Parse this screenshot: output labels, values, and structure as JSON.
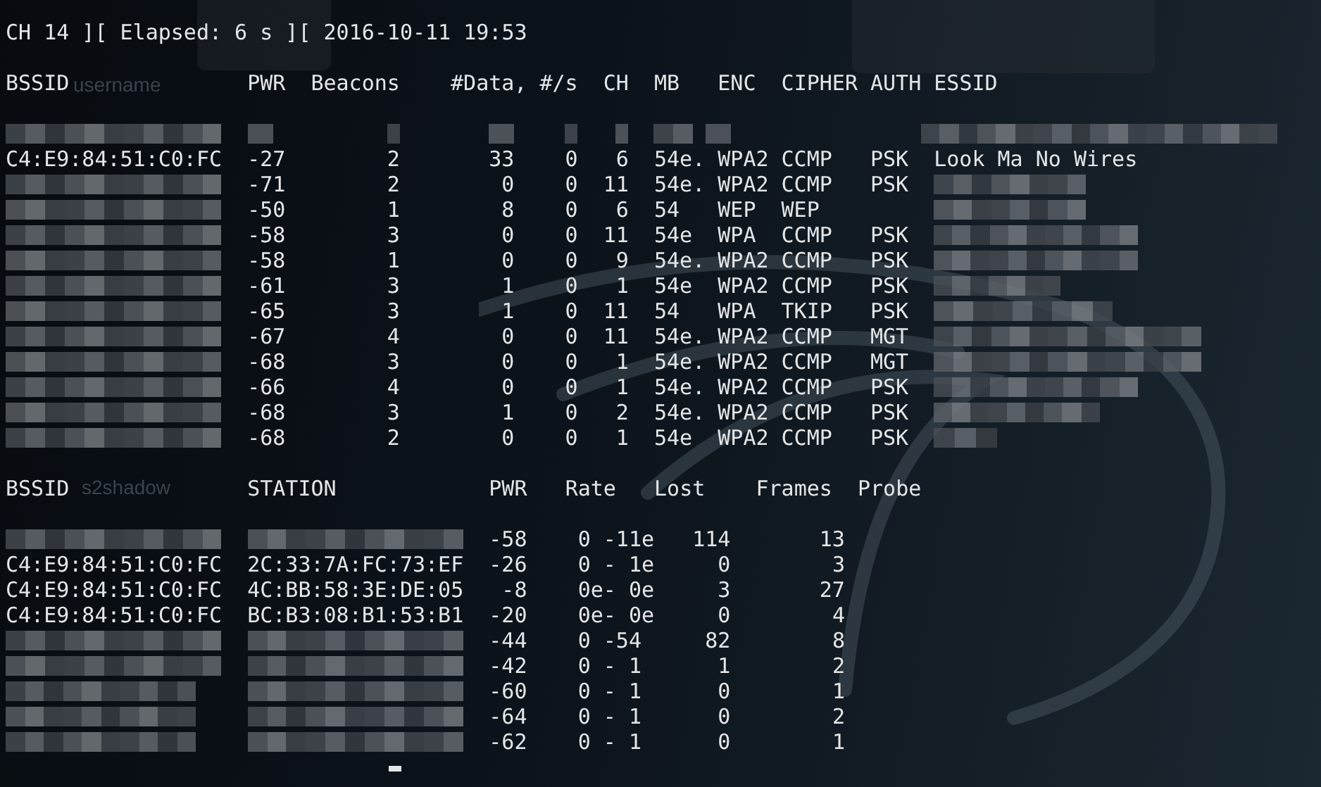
{
  "status_line": "CH 14 ][ Elapsed: 6 s ][ 2016-10-11 19:53",
  "desktop_icons": [
    {
      "label": "username"
    },
    {
      "label": "s2shadow"
    }
  ],
  "access_points": {
    "columns": [
      "BSSID",
      "PWR",
      "Beacons",
      "#Data, #/s",
      "CH",
      "MB",
      "ENC",
      "CIPHER",
      "AUTH",
      "ESSID"
    ],
    "rows": [
      {
        "redacted": true
      },
      {
        "bssid": "C4:E9:84:51:C0:FC",
        "pwr": "-27",
        "beacons": "2",
        "data": "33",
        "per_sec": "0",
        "ch": "6",
        "mb": "54e.",
        "enc": "WPA2",
        "cipher": "CCMP",
        "auth": "PSK",
        "essid": "Look Ma No Wires"
      },
      {
        "pwr": "-71",
        "beacons": "2",
        "data": "0",
        "per_sec": "0",
        "ch": "11",
        "mb": "54e.",
        "enc": "WPA2",
        "cipher": "CCMP",
        "auth": "PSK"
      },
      {
        "pwr": "-50",
        "beacons": "1",
        "data": "8",
        "per_sec": "0",
        "ch": "6",
        "mb": "54",
        "enc": "WEP",
        "cipher": "WEP"
      },
      {
        "pwr": "-58",
        "beacons": "3",
        "data": "0",
        "per_sec": "0",
        "ch": "11",
        "mb": "54e",
        "enc": "WPA",
        "cipher": "CCMP",
        "auth": "PSK"
      },
      {
        "pwr": "-58",
        "beacons": "1",
        "data": "0",
        "per_sec": "0",
        "ch": "9",
        "mb": "54e.",
        "enc": "WPA2",
        "cipher": "CCMP",
        "auth": "PSK"
      },
      {
        "pwr": "-61",
        "beacons": "3",
        "data": "1",
        "per_sec": "0",
        "ch": "1",
        "mb": "54e",
        "enc": "WPA2",
        "cipher": "CCMP",
        "auth": "PSK"
      },
      {
        "pwr": "-65",
        "beacons": "3",
        "data": "1",
        "per_sec": "0",
        "ch": "11",
        "mb": "54",
        "enc": "WPA",
        "cipher": "TKIP",
        "auth": "PSK"
      },
      {
        "pwr": "-67",
        "beacons": "4",
        "data": "0",
        "per_sec": "0",
        "ch": "11",
        "mb": "54e.",
        "enc": "WPA2",
        "cipher": "CCMP",
        "auth": "MGT"
      },
      {
        "pwr": "-68",
        "beacons": "3",
        "data": "0",
        "per_sec": "0",
        "ch": "1",
        "mb": "54e.",
        "enc": "WPA2",
        "cipher": "CCMP",
        "auth": "MGT"
      },
      {
        "pwr": "-66",
        "beacons": "4",
        "data": "0",
        "per_sec": "0",
        "ch": "1",
        "mb": "54e.",
        "enc": "WPA2",
        "cipher": "CCMP",
        "auth": "PSK"
      },
      {
        "pwr": "-68",
        "beacons": "3",
        "data": "1",
        "per_sec": "0",
        "ch": "2",
        "mb": "54e.",
        "enc": "WPA2",
        "cipher": "CCMP",
        "auth": "PSK"
      },
      {
        "pwr": "-68",
        "beacons": "2",
        "data": "0",
        "per_sec": "0",
        "ch": "1",
        "mb": "54e",
        "enc": "WPA2",
        "cipher": "CCMP",
        "auth": "PSK"
      }
    ]
  },
  "stations": {
    "columns": [
      "BSSID",
      "STATION",
      "PWR",
      "Rate",
      "Lost",
      "Frames",
      "Probe"
    ],
    "rows": [
      {
        "pwr": "-58",
        "rate": "0 -11e",
        "lost": "114",
        "frames": "13"
      },
      {
        "bssid": "C4:E9:84:51:C0:FC",
        "station": "2C:33:7A:FC:73:EF",
        "pwr": "-26",
        "rate": "0 - 1e",
        "lost": "0",
        "frames": "3"
      },
      {
        "bssid": "C4:E9:84:51:C0:FC",
        "station": "4C:BB:58:3E:DE:05",
        "pwr": "-8",
        "rate": "0e- 0e",
        "lost": "3",
        "frames": "27"
      },
      {
        "bssid": "C4:E9:84:51:C0:FC",
        "station": "BC:B3:08:B1:53:B1",
        "pwr": "-20",
        "rate": "0e- 0e",
        "lost": "0",
        "frames": "4"
      },
      {
        "pwr": "-44",
        "rate": "0 -54",
        "lost": "82",
        "frames": "8"
      },
      {
        "pwr": "-42",
        "rate": "0 - 1",
        "lost": "1",
        "frames": "2"
      },
      {
        "pwr": "-60",
        "rate": "0 - 1",
        "lost": "0",
        "frames": "1"
      },
      {
        "pwr": "-64",
        "rate": "0 - 1",
        "lost": "0",
        "frames": "2"
      },
      {
        "pwr": "-62",
        "rate": "0 - 1",
        "lost": "0",
        "frames": "1"
      }
    ]
  }
}
